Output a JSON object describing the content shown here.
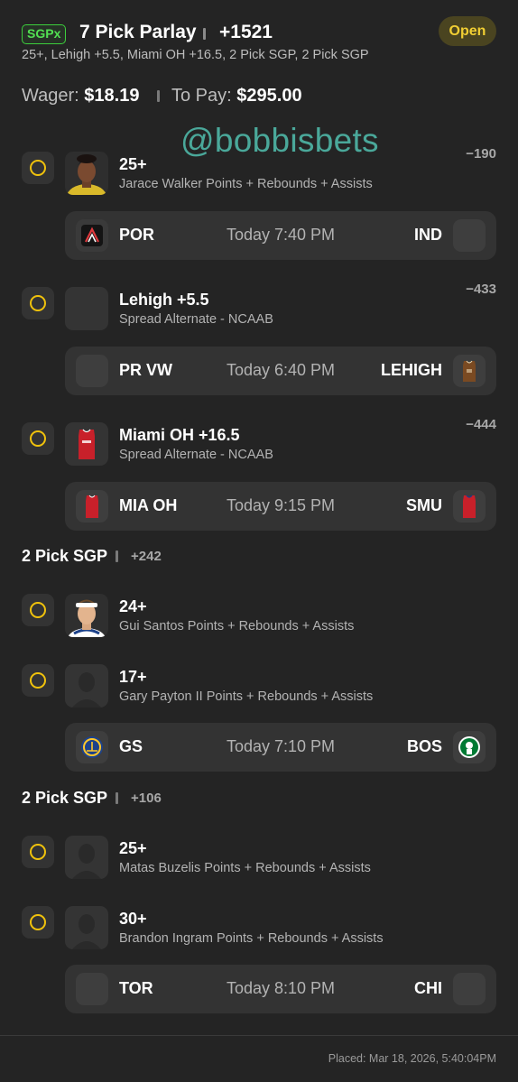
{
  "header": {
    "badge": "SGPx",
    "title": "7 Pick Parlay",
    "odds": "+1521",
    "status": "Open",
    "subtitle": "25+, Lehigh +5.5, Miami OH +16.5, 2 Pick SGP, 2 Pick SGP"
  },
  "wager": {
    "label": "Wager:",
    "value": "$18.19",
    "to_pay_label": "To Pay:",
    "to_pay_value": "$295.00"
  },
  "watermark": "@bobbisbets",
  "picks": [
    {
      "main": "25+",
      "sub": "Jarace Walker Points + Rebounds + Assists",
      "odds": "−190",
      "icon": "player-photo-icon"
    },
    {
      "main": "Lehigh +5.5",
      "sub": "Spread Alternate - NCAAB",
      "odds": "−433",
      "icon": "placeholder-icon"
    },
    {
      "main": "Miami OH +16.5",
      "sub": "Spread Alternate - NCAAB",
      "odds": "−444",
      "icon": "jersey-icon"
    },
    {
      "main": "24+",
      "sub": "Gui Santos Points + Rebounds + Assists",
      "icon": "player-photo-icon"
    },
    {
      "main": "17+",
      "sub": "Gary Payton II Points + Rebounds + Assists",
      "icon": "player-silhouette-icon"
    },
    {
      "main": "25+",
      "sub": "Matas Buzelis Points + Rebounds + Assists",
      "icon": "player-silhouette-icon"
    },
    {
      "main": "30+",
      "sub": "Brandon Ingram Points + Rebounds + Assists",
      "icon": "player-silhouette-icon"
    }
  ],
  "games": [
    {
      "home": "POR",
      "time": "Today 7:40 PM",
      "away": "IND"
    },
    {
      "home": "PR VW",
      "time": "Today 6:40 PM",
      "away": "LEHIGH"
    },
    {
      "home": "MIA OH",
      "time": "Today 9:15 PM",
      "away": "SMU"
    },
    {
      "home": "GS",
      "time": "Today 7:10 PM",
      "away": "BOS"
    },
    {
      "home": "TOR",
      "time": "Today 8:10 PM",
      "away": "CHI"
    }
  ],
  "groups": [
    {
      "title": "2 Pick SGP",
      "odds": "+242"
    },
    {
      "title": "2 Pick SGP",
      "odds": "+106"
    }
  ],
  "footer": {
    "placed": "Placed: Mar 18, 2026, 5:40:04PM"
  },
  "colors": {
    "background": "#242424",
    "card": "#333333",
    "accent_yellow": "#f0c20c",
    "badge_green": "#3ccf3c",
    "watermark": "#4aa89a"
  }
}
